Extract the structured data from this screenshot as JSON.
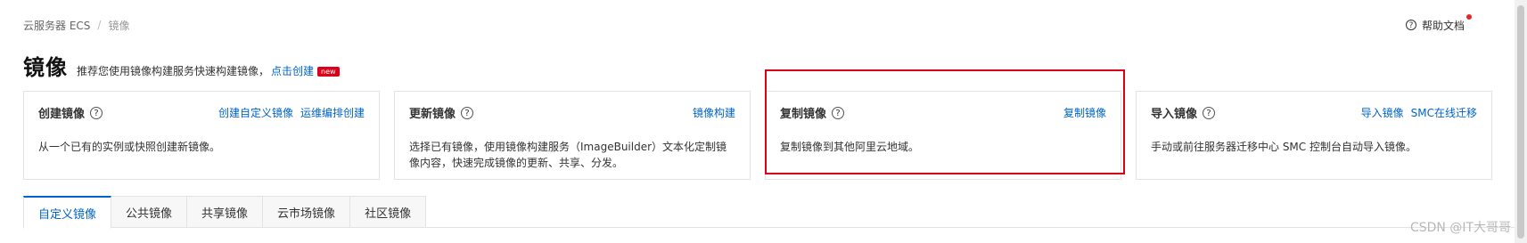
{
  "breadcrumb": {
    "root": "云服务器 ECS",
    "separator": "/",
    "current": "镜像"
  },
  "help": {
    "label": "帮助文档",
    "icon": "question-circle-icon"
  },
  "header": {
    "title": "镜像",
    "subtitle": "推荐您使用镜像构建服务快速构建镜像，",
    "create_link": "点击创建",
    "badge": "new"
  },
  "cards": [
    {
      "title": "创建镜像",
      "links": [
        "创建自定义镜像",
        "运维编排创建"
      ],
      "desc": "从一个已有的实例或快照创建新镜像。"
    },
    {
      "title": "更新镜像",
      "links": [
        "镜像构建"
      ],
      "desc": "选择已有镜像，使用镜像构建服务（ImageBuilder）文本化定制镜像内容，快速完成镜像的更新、共享、分发。"
    },
    {
      "title": "复制镜像",
      "links": [
        "复制镜像"
      ],
      "desc": "复制镜像到其他阿里云地域。"
    },
    {
      "title": "导入镜像",
      "links": [
        "导入镜像",
        "SMC在线迁移"
      ],
      "desc": "手动或前往服务器迁移中心 SMC 控制台自动导入镜像。"
    }
  ],
  "tabs": [
    {
      "label": "自定义镜像",
      "active": true
    },
    {
      "label": "公共镜像",
      "active": false
    },
    {
      "label": "共享镜像",
      "active": false
    },
    {
      "label": "云市场镜像",
      "active": false
    },
    {
      "label": "社区镜像",
      "active": false
    }
  ],
  "watermark": "CSDN @IT大哥哥",
  "colors": {
    "accent": "#0064c8",
    "highlight": "#d9001b",
    "badge": "#d9001b"
  }
}
